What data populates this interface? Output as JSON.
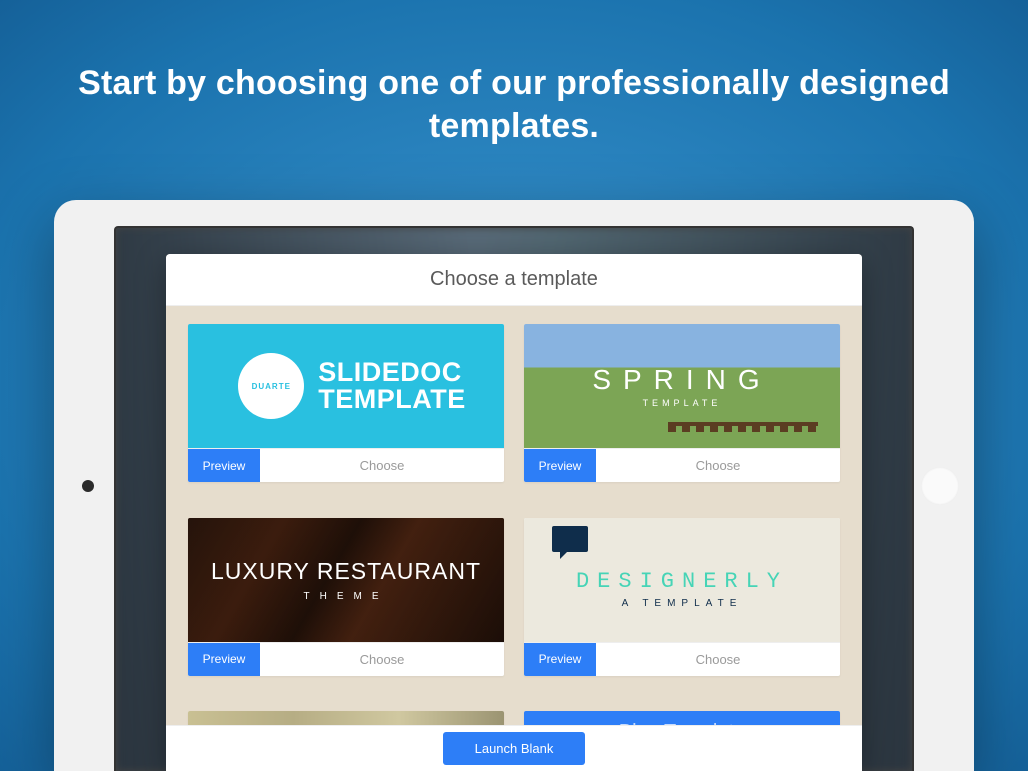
{
  "headline": "Start by choosing one of our professionally designed templates.",
  "modal": {
    "title": "Choose a template",
    "launch_label": "Launch Blank"
  },
  "actions": {
    "preview": "Preview",
    "choose": "Choose"
  },
  "templates": [
    {
      "badge": "DUARTE",
      "title_line1": "SLIDEDOC",
      "title_line2": "TEMPLATE"
    },
    {
      "title": "SPRING",
      "subtitle": "TEMPLATE"
    },
    {
      "title": "LUXURY RESTAURANT",
      "subtitle": "THEME"
    },
    {
      "title": "DESIGNERLY",
      "subtitle": "A TEMPLATE"
    },
    {
      "title": ""
    },
    {
      "title": "Blue Template"
    }
  ]
}
